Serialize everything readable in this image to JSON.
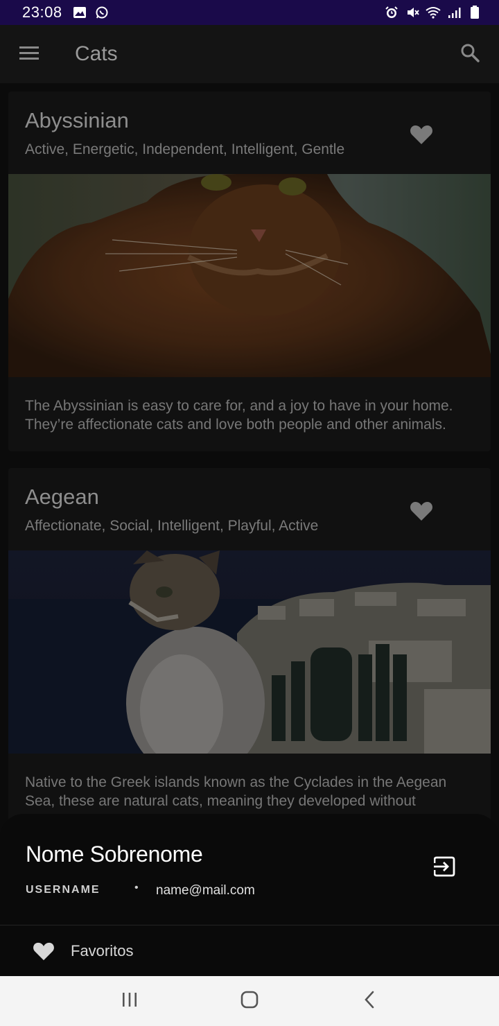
{
  "status_bar": {
    "time": "23:08",
    "left_icons": [
      "gallery-icon",
      "whatsapp-icon"
    ],
    "right_icons": [
      "alarm-icon",
      "mute-icon",
      "wifi-icon",
      "signal-icon",
      "battery-icon"
    ],
    "background": "#1a0a4a"
  },
  "app_bar": {
    "title": "Cats",
    "menu_icon": "hamburger-menu-icon",
    "search_icon": "search-icon"
  },
  "cards": [
    {
      "name": "Abyssinian",
      "traits": "Active, Energetic, Independent, Intelligent, Gentle",
      "description_line1": "The Abyssinian is easy to care for, and a joy to have in your home.",
      "description_line2": "They’re affectionate cats and love both people and other animals.",
      "favorite_icon": "heart-icon"
    },
    {
      "name": "Aegean",
      "traits": "Affectionate, Social, Intelligent, Playful, Active",
      "description_line1": "Native to the Greek islands known as the Cyclades in the Aegean",
      "description_line2": "Sea, these are natural cats, meaning they developed without",
      "favorite_icon": "heart-icon"
    }
  ],
  "bottom_sheet": {
    "user_name": "Nome Sobrenome",
    "username_label": "USERNAME",
    "separator": "•",
    "email": "name@mail.com",
    "logout_icon": "logout-icon",
    "items": [
      {
        "label": "Favoritos",
        "icon": "heart-icon"
      }
    ]
  },
  "nav_bar": {
    "buttons": [
      "recent-apps-icon",
      "home-icon",
      "back-icon"
    ],
    "background": "#f4f4f4"
  }
}
